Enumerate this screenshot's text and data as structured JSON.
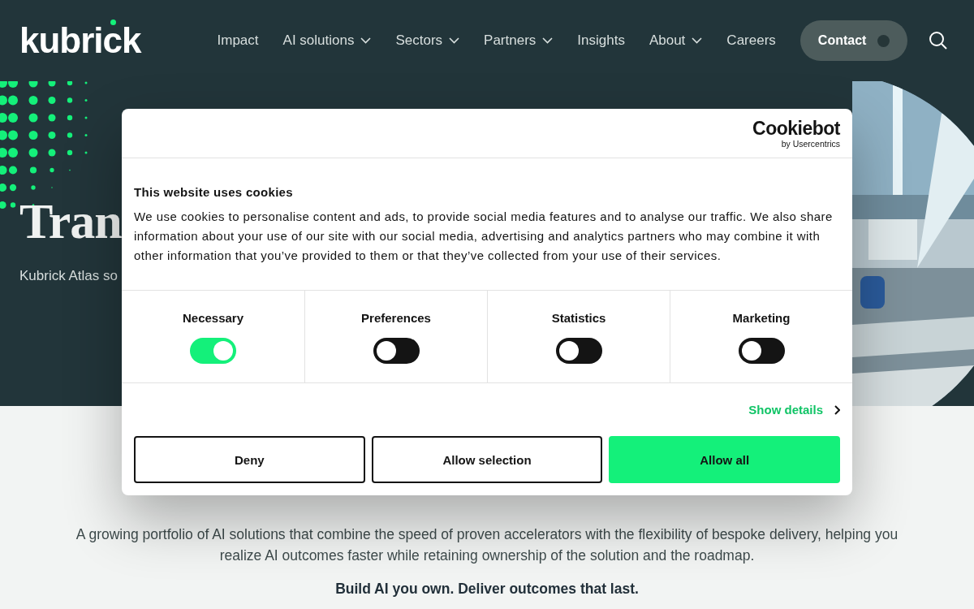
{
  "header": {
    "logo": "kubrick",
    "nav": [
      {
        "label": "Impact",
        "dropdown": false
      },
      {
        "label": "AI solutions",
        "dropdown": true
      },
      {
        "label": "Sectors",
        "dropdown": true
      },
      {
        "label": "Partners",
        "dropdown": true
      },
      {
        "label": "Insights",
        "dropdown": false
      },
      {
        "label": "About",
        "dropdown": true
      },
      {
        "label": "Careers",
        "dropdown": false
      }
    ],
    "contact_button": "Contact"
  },
  "hero": {
    "title": "Tran",
    "subtitle": "Kubrick Atlas so"
  },
  "section": {
    "paragraph": "A growing portfolio of AI solutions that combine the speed of proven accelerators with the flexibility of bespoke delivery, helping you realize AI outcomes faster while retaining ownership of the solution and the roadmap.",
    "tagline": "Build AI you own. Deliver outcomes that last."
  },
  "cookie_dialog": {
    "brand": "Cookiebot",
    "brand_sub": "by Usercentrics",
    "title": "This website uses cookies",
    "body": "We use cookies to personalise content and ads, to provide social media features and to analyse our traffic. We also share information about your use of our site with our social media, advertising and analytics partners who may combine it with other information that you’ve provided to them or that they’ve collected from your use of their services.",
    "categories": [
      {
        "label": "Necessary",
        "checked": true
      },
      {
        "label": "Preferences",
        "checked": false
      },
      {
        "label": "Statistics",
        "checked": false
      },
      {
        "label": "Marketing",
        "checked": false
      }
    ],
    "show_details": "Show details",
    "buttons": [
      {
        "label": "Deny",
        "kind": "outline"
      },
      {
        "label": "Allow selection",
        "kind": "outline"
      },
      {
        "label": "Allow all",
        "kind": "primary"
      }
    ]
  }
}
